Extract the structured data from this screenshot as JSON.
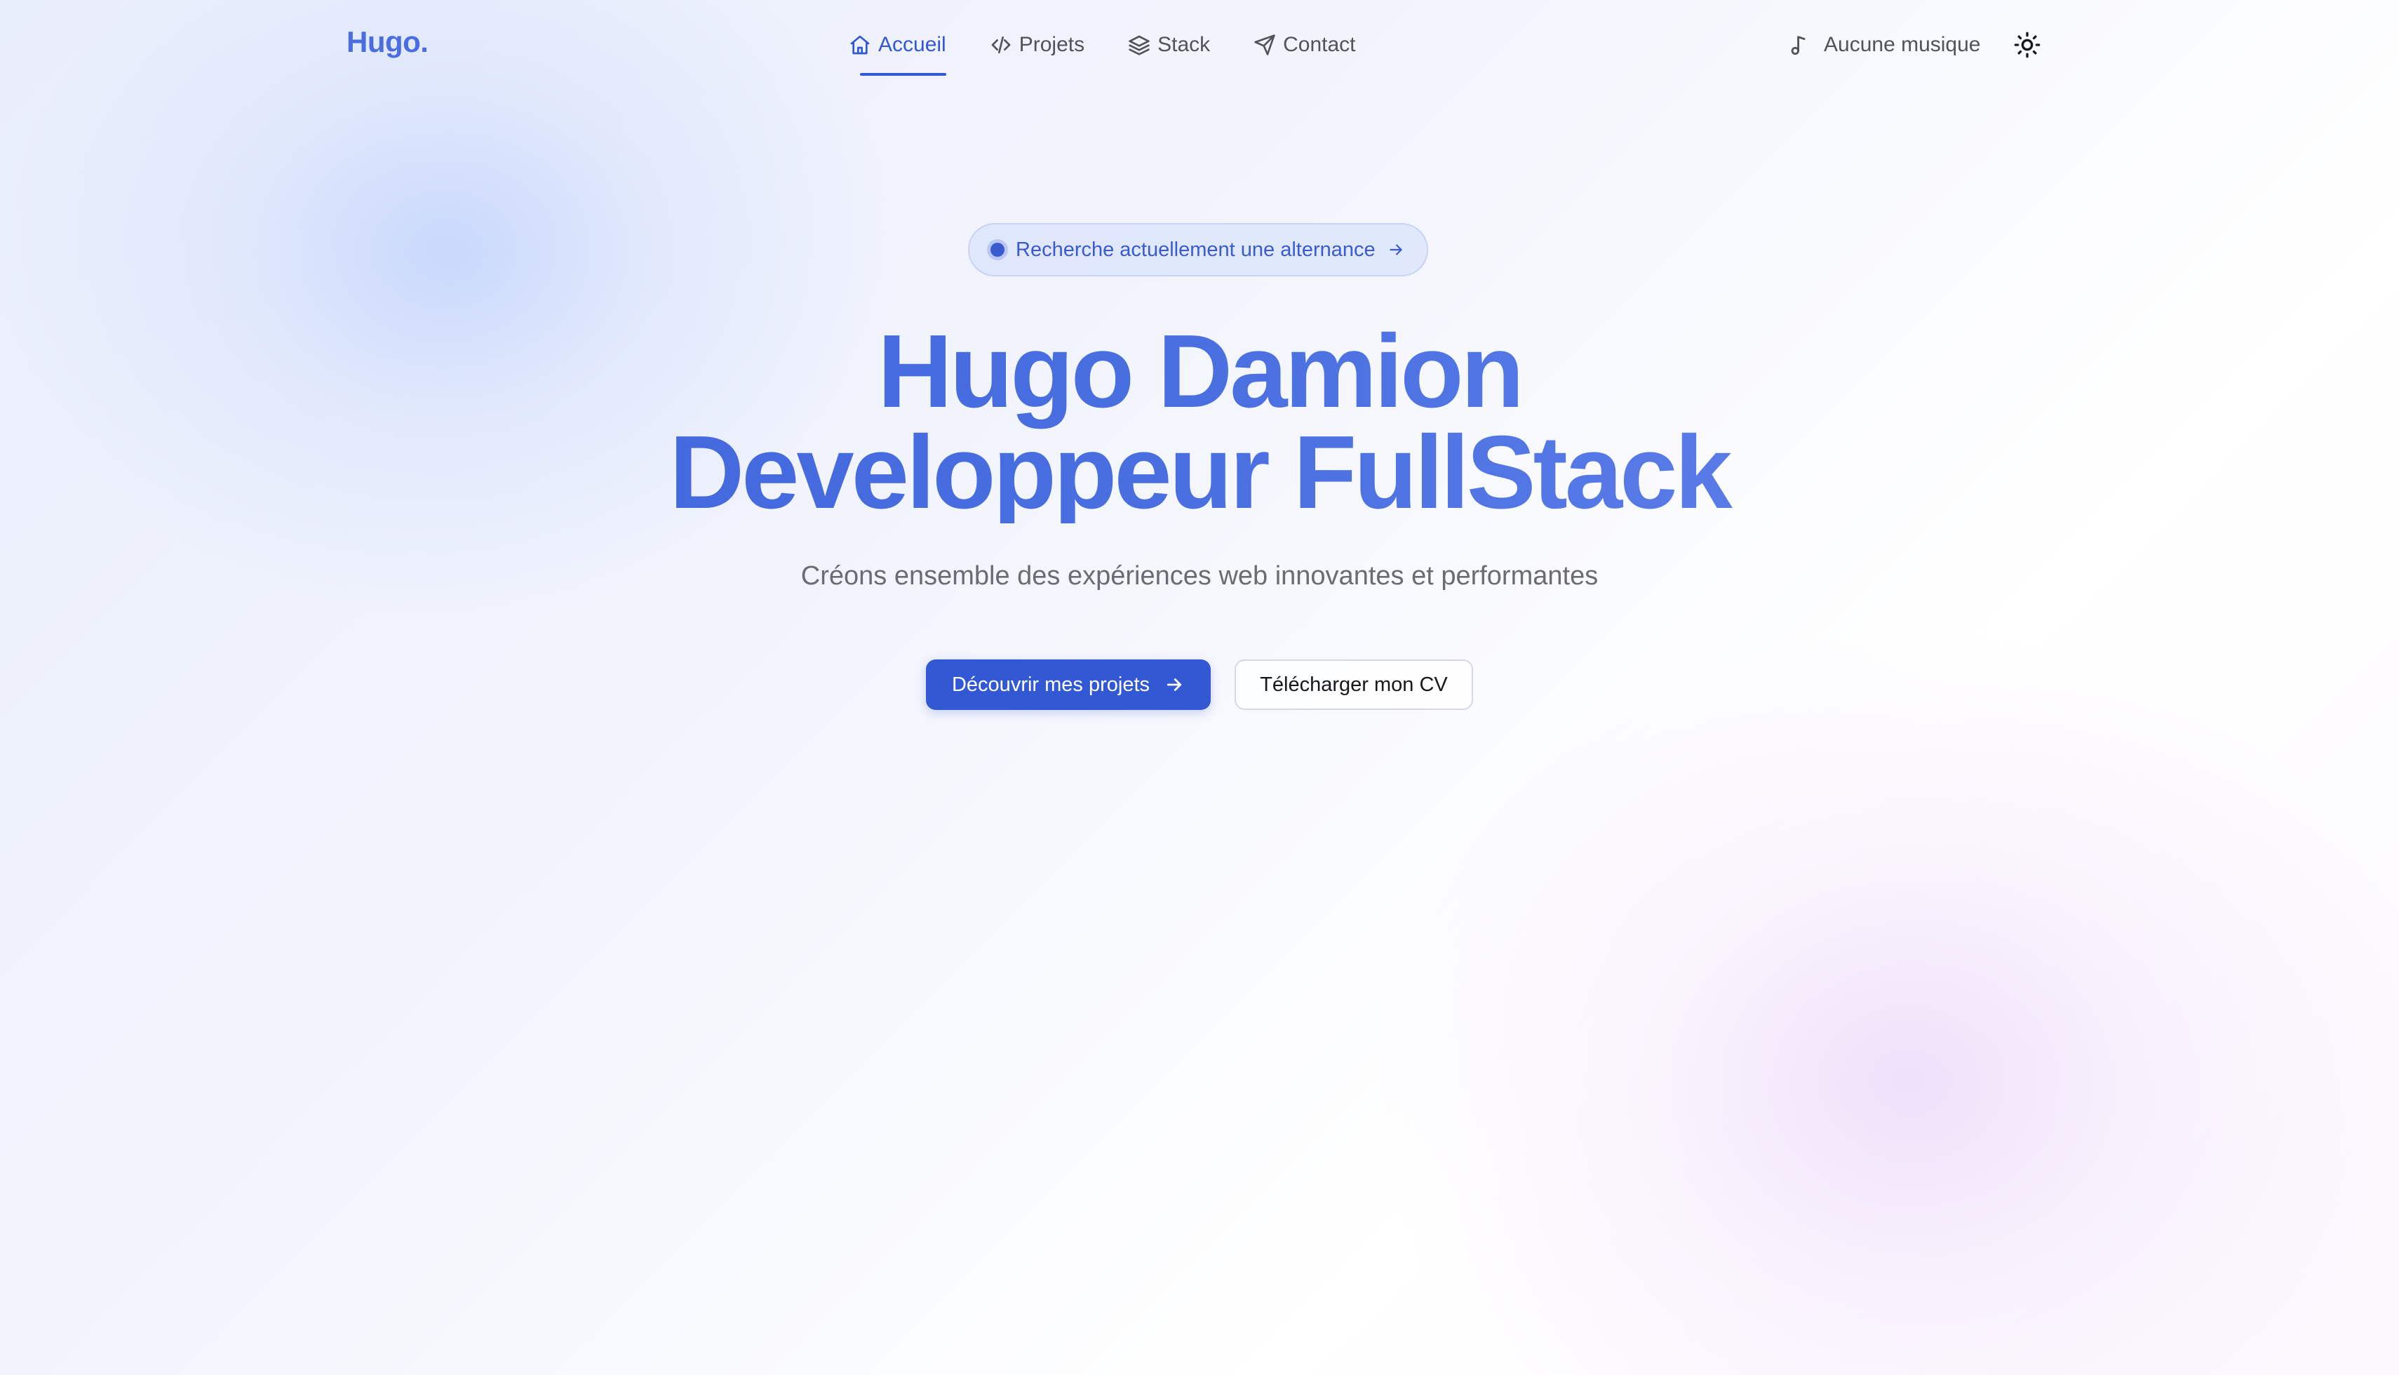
{
  "brand": {
    "logo": "Hugo."
  },
  "nav": {
    "items": [
      {
        "label": "Accueil",
        "icon": "home-icon",
        "active": true
      },
      {
        "label": "Projets",
        "icon": "code-icon",
        "active": false
      },
      {
        "label": "Stack",
        "icon": "layers-icon",
        "active": false
      },
      {
        "label": "Contact",
        "icon": "send-icon",
        "active": false
      }
    ]
  },
  "music": {
    "label": "Aucune musique",
    "icon": "music-note-icon"
  },
  "theme_toggle": {
    "icon": "sun-icon"
  },
  "hero": {
    "badge": "Recherche actuellement une alternance",
    "title_line1": "Hugo Damion",
    "title_line2": "Developpeur FullStack",
    "subtitle": "Créons ensemble des expériences web innovantes et performantes",
    "primary_button": "Découvrir mes projets",
    "secondary_button": "Télécharger mon CV"
  },
  "colors": {
    "accent": "#3358d4",
    "title_gradient_start": "#3a62dc",
    "title_gradient_end": "#6a8af0",
    "text_muted": "#6b6b73"
  }
}
